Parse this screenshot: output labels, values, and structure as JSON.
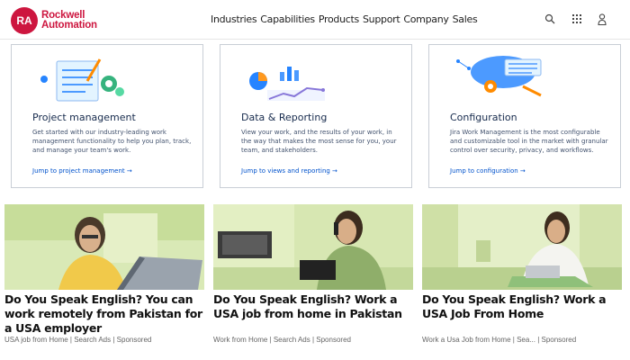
{
  "header": {
    "logo_mark": "RA",
    "logo_line1": "Rockwell",
    "logo_line2": "Automation",
    "nav": [
      "Industries",
      "Capabilities",
      "Products",
      "Support",
      "Company",
      "Sales"
    ],
    "icons": [
      "search-icon",
      "grid-icon",
      "user-icon"
    ]
  },
  "colors": {
    "brand": "#cd163f",
    "link": "#0052cc",
    "title": "#172b4d"
  },
  "cards": [
    {
      "title": "Project management",
      "description": "Get started with our industry-leading work management functionality to help you plan, track, and manage your team's work.",
      "link": "Jump to project management →"
    },
    {
      "title": "Data & Reporting",
      "description": "View your work, and the results of your work, in the way that makes the most sense for you, your team, and stakeholders.",
      "link": "Jump to views and reporting →"
    },
    {
      "title": "Configuration",
      "description": "Jira Work Management is the most configurable and customizable tool in the market with granular control over security, privacy, and workflows.",
      "link": "Jump to configuration →"
    }
  ],
  "ads": [
    {
      "headline": "Do You Speak English? You can work remotely from Pakistan for a USA employer",
      "source": "USA job from Home | Search Ads | Sponsored"
    },
    {
      "headline": "Do You Speak English? Work a USA job from home in Pakistan",
      "source": "Work from Home | Search Ads | Sponsored"
    },
    {
      "headline": "Do You Speak English? Work a USA Job From Home",
      "source": "Work a Usa Job from Home | Sea... | Sponsored"
    }
  ]
}
